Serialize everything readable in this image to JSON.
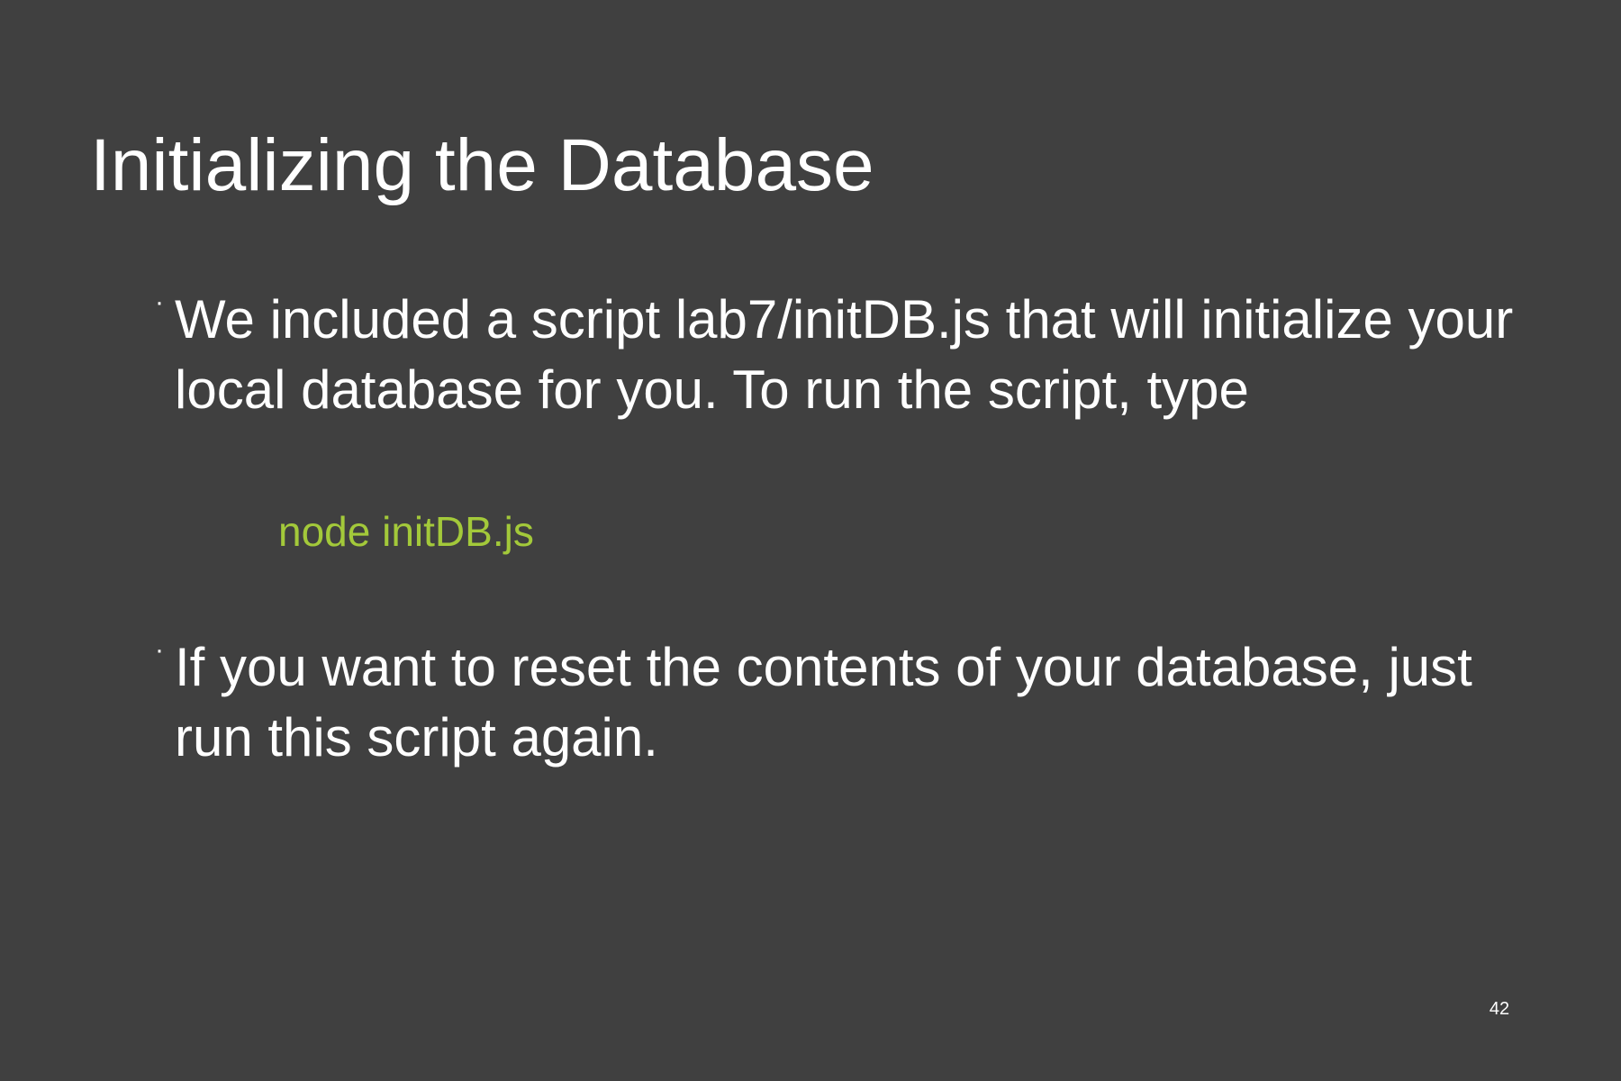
{
  "slide": {
    "title": "Initializing the Database",
    "bullets": [
      {
        "marker": "·",
        "text": "We included a script lab7/initDB.js that will initialize your local database for you.  To run the script, type"
      },
      {
        "marker": "·",
        "text": "If you want to reset the contents of your database, just run this script again."
      }
    ],
    "code": "node initDB.js",
    "page_number": "42"
  },
  "colors": {
    "background": "#404040",
    "text": "#ffffff",
    "code": "#a3c93a"
  }
}
